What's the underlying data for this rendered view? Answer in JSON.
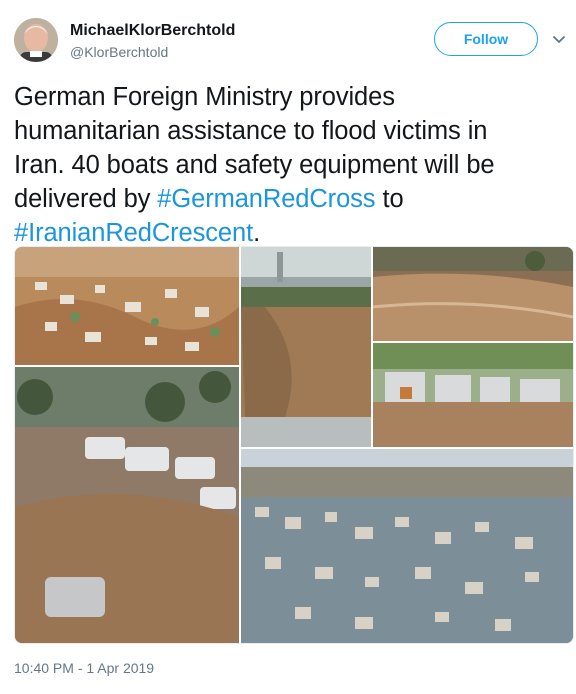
{
  "author": {
    "name": "MichaelKlorBerchtold",
    "handle": "@KlorBerchtold"
  },
  "follow_label": "Follow",
  "tweet": {
    "line1": "German Foreign Ministry provides",
    "line2": "humanitarian assistance to flood victims in",
    "line3": "Iran. 40 boats and safety equipment will be",
    "line4_pre": "delivered by ",
    "hashtag1": "#GermanRedCross",
    "line4_post": " to",
    "hashtag2": "#IranianRedCrescent",
    "line5_post": "."
  },
  "timestamp": "10:40 PM - 1 Apr 2019",
  "colors": {
    "accent": "#1da1f2",
    "hashtag": "#1b95e0",
    "muted": "#657786"
  },
  "icons": {
    "more": "chevron-down-icon"
  }
}
